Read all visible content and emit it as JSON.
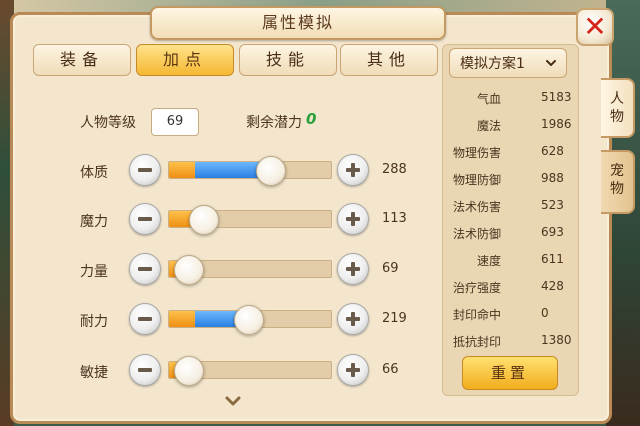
{
  "dialog": {
    "title": "属性模拟",
    "close_symbol": "✕"
  },
  "tabs": [
    {
      "label": "装备",
      "active": false
    },
    {
      "label": "加点",
      "active": true
    },
    {
      "label": "技能",
      "active": false
    },
    {
      "label": "其他",
      "active": false
    }
  ],
  "level": {
    "label": "人物等级",
    "value": "69"
  },
  "potential": {
    "label": "剩余潜力",
    "value": "0"
  },
  "attributes": [
    {
      "label": "体质",
      "value": "288",
      "base_fraction": 0.16,
      "added_fraction": 0.46
    },
    {
      "label": "魔力",
      "value": "113",
      "base_fraction": 0.16,
      "added_fraction": 0.0
    },
    {
      "label": "力量",
      "value": "69",
      "base_fraction": 0.07,
      "added_fraction": 0.0
    },
    {
      "label": "耐力",
      "value": "219",
      "base_fraction": 0.16,
      "added_fraction": 0.33
    },
    {
      "label": "敏捷",
      "value": "66",
      "base_fraction": 0.07,
      "added_fraction": 0.0
    }
  ],
  "scheme": {
    "label": "模拟方案1"
  },
  "stats": [
    {
      "key": "气血",
      "value": "5183"
    },
    {
      "key": "魔法",
      "value": "1986"
    },
    {
      "key": "物理伤害",
      "value": "628"
    },
    {
      "key": "物理防御",
      "value": "988"
    },
    {
      "key": "法术伤害",
      "value": "523"
    },
    {
      "key": "法术防御",
      "value": "693"
    },
    {
      "key": "速度",
      "value": "611"
    },
    {
      "key": "治疗强度",
      "value": "428"
    },
    {
      "key": "封印命中",
      "value": "0"
    },
    {
      "key": "抵抗封印",
      "value": "1380"
    }
  ],
  "reset_label": "重置",
  "side_tabs": [
    {
      "chars": [
        "人",
        "物"
      ],
      "active": true
    },
    {
      "chars": [
        "宠",
        "物"
      ],
      "active": false
    }
  ],
  "colors": {
    "base_fill": "#f0a020",
    "added_fill": "#3b8ef0",
    "potential": "#2aa03a",
    "close": "#d62418"
  }
}
